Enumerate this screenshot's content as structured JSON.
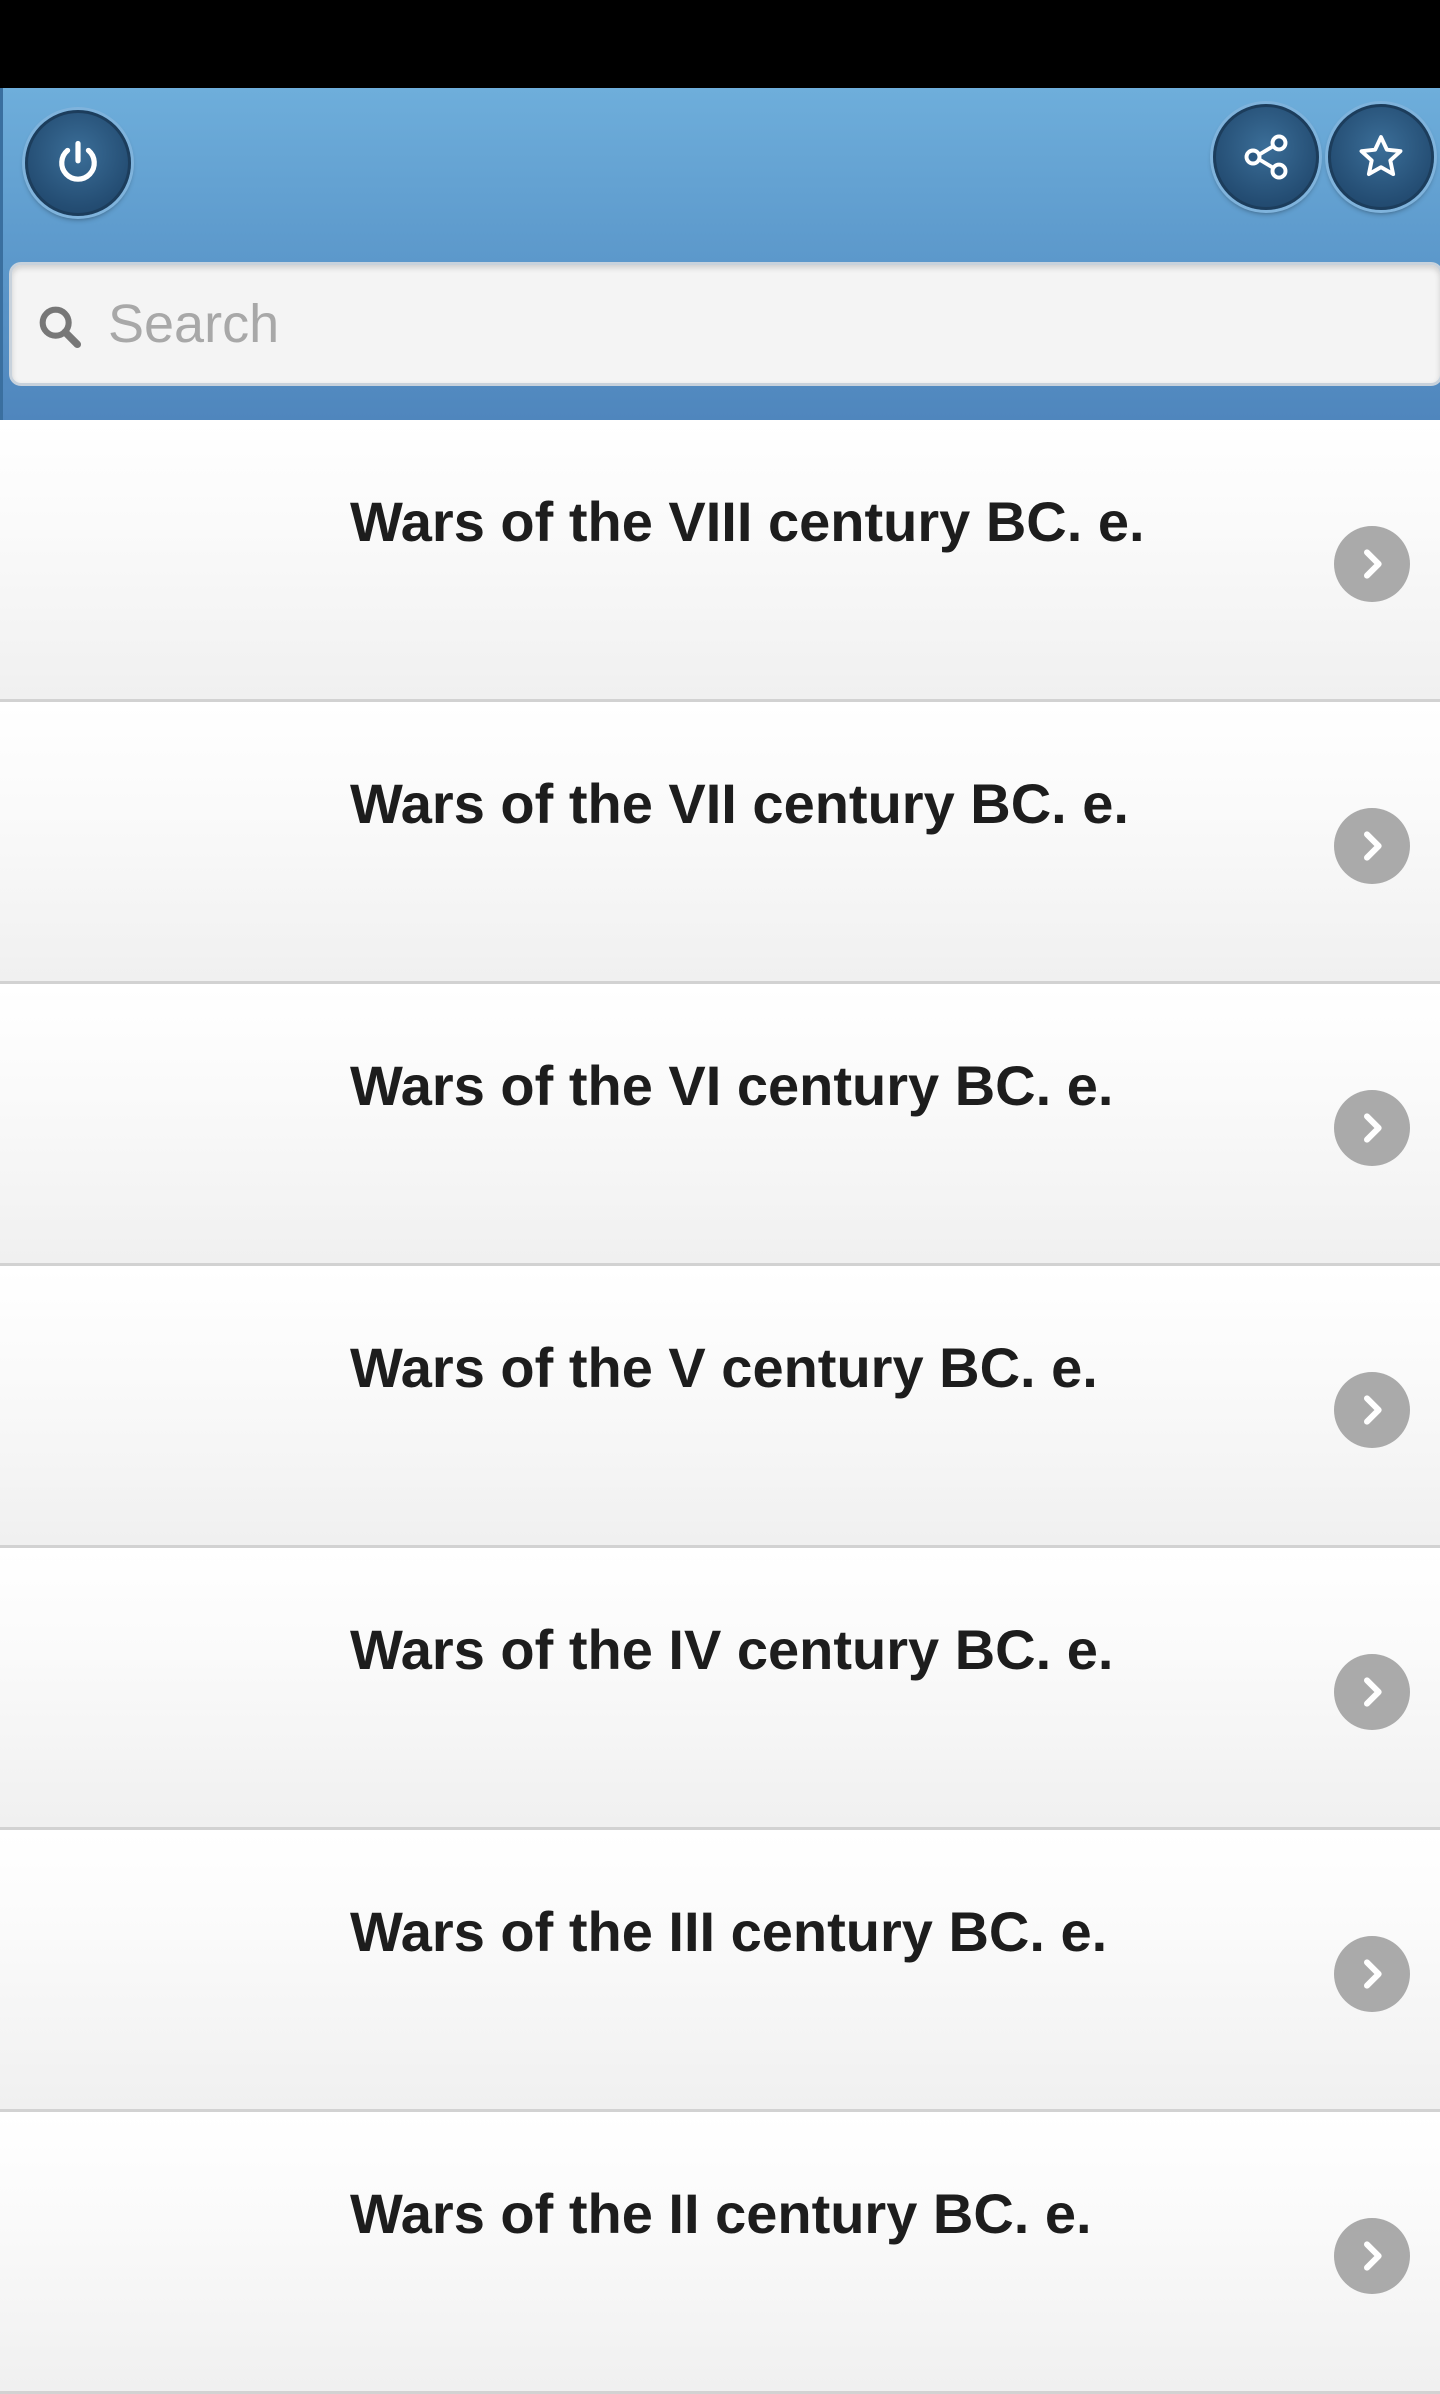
{
  "header": {
    "power_icon": "power-icon",
    "share_icon": "share-icon",
    "star_icon": "star-icon"
  },
  "search": {
    "placeholder": "Search",
    "value": "",
    "icon": "search-icon"
  },
  "list": {
    "items": [
      {
        "label": "Wars of the VIII century BC. e."
      },
      {
        "label": "Wars of the VII century BC. e."
      },
      {
        "label": "Wars of the VI century BC. e."
      },
      {
        "label": "Wars of the V century BC. e."
      },
      {
        "label": "Wars of the IV century BC. e."
      },
      {
        "label": "Wars of the III century BC. e."
      },
      {
        "label": "Wars of the II century BC. e."
      }
    ],
    "chevron_icon": "chevron-right-icon"
  },
  "colors": {
    "header_top": "#6eaedb",
    "header_bottom": "#4f86bd",
    "button_fill": "#244d73",
    "chevron_bg": "#aaaaaa",
    "status_bar": "#000000"
  }
}
